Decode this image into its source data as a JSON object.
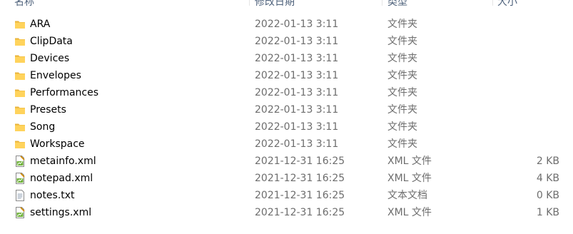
{
  "header": {
    "name": "名称",
    "date": "修改日期",
    "type": "类型",
    "size": "大小"
  },
  "files": [
    {
      "name": "ARA",
      "date": "2022-01-13 3:11",
      "type": "文件夹",
      "size": "",
      "icon": "folder-icon"
    },
    {
      "name": "ClipData",
      "date": "2022-01-13 3:11",
      "type": "文件夹",
      "size": "",
      "icon": "folder-icon"
    },
    {
      "name": "Devices",
      "date": "2022-01-13 3:11",
      "type": "文件夹",
      "size": "",
      "icon": "folder-icon"
    },
    {
      "name": "Envelopes",
      "date": "2022-01-13 3:11",
      "type": "文件夹",
      "size": "",
      "icon": "folder-icon"
    },
    {
      "name": "Performances",
      "date": "2022-01-13 3:11",
      "type": "文件夹",
      "size": "",
      "icon": "folder-icon"
    },
    {
      "name": "Presets",
      "date": "2022-01-13 3:11",
      "type": "文件夹",
      "size": "",
      "icon": "folder-icon"
    },
    {
      "name": "Song",
      "date": "2022-01-13 3:11",
      "type": "文件夹",
      "size": "",
      "icon": "folder-icon"
    },
    {
      "name": "Workspace",
      "date": "2022-01-13 3:11",
      "type": "文件夹",
      "size": "",
      "icon": "folder-icon"
    },
    {
      "name": "metainfo.xml",
      "date": "2021-12-31 16:25",
      "type": "XML 文件",
      "size": "2 KB",
      "icon": "xml-file-icon"
    },
    {
      "name": "notepad.xml",
      "date": "2021-12-31 16:25",
      "type": "XML 文件",
      "size": "4 KB",
      "icon": "xml-file-icon"
    },
    {
      "name": "notes.txt",
      "date": "2021-12-31 16:25",
      "type": "文本文档",
      "size": "0 KB",
      "icon": "text-file-icon"
    },
    {
      "name": "settings.xml",
      "date": "2021-12-31 16:25",
      "type": "XML 文件",
      "size": "1 KB",
      "icon": "xml-file-icon"
    }
  ]
}
